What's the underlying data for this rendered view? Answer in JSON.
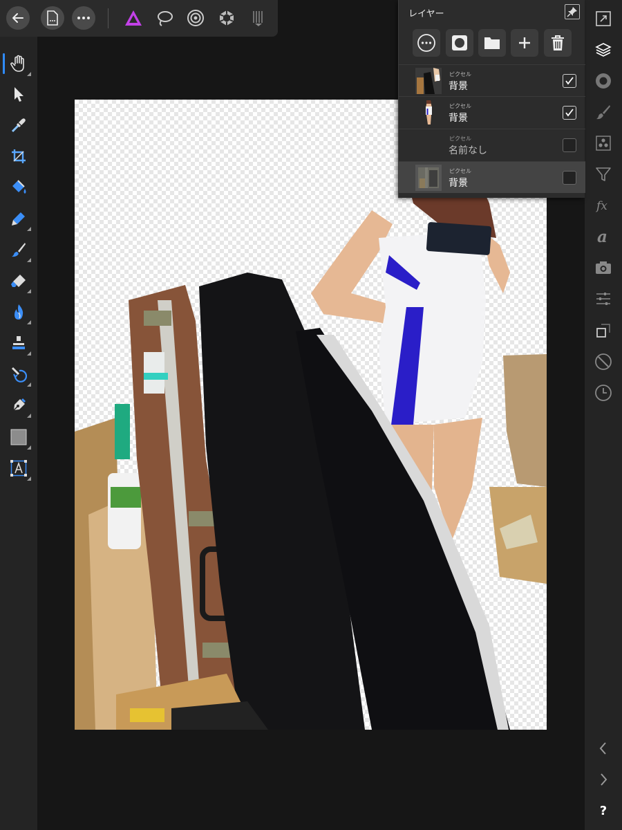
{
  "colors": {
    "background": "#161616",
    "toolbar": "#2b2b2b",
    "panel": "#2c2c2c",
    "accent": "#2f8cff",
    "affinity_photo_icon": "#c341e8"
  },
  "top_toolbar": {
    "icons": [
      "back-arrow-icon",
      "document-icon",
      "more-icon",
      "photo-persona-icon",
      "selection-persona-icon",
      "liquify-persona-icon",
      "develop-persona-icon",
      "export-persona-icon"
    ]
  },
  "left_tools": {
    "icons": [
      "hand-icon",
      "move-icon",
      "color-picker-icon",
      "crop-icon",
      "fill-icon",
      "selection-brush-icon",
      "paint-brush-icon",
      "eraser-icon",
      "burn-icon",
      "clone-icon",
      "healing-icon",
      "pen-icon",
      "rectangle-icon",
      "text-icon"
    ],
    "active": "hand-icon"
  },
  "right_bar": {
    "icons": [
      "navigator-icon",
      "layers-icon",
      "color-icon",
      "brushes-icon",
      "channels-icon",
      "filter-icon",
      "fx-icon",
      "text-styles-icon",
      "snapshots-icon",
      "adjustments-icon",
      "transform-icon",
      "stock-icon",
      "history-icon"
    ],
    "bottom": {
      "help_label": "?",
      "nav_icons": [
        "chevron-left-icon",
        "chevron-right-icon"
      ]
    }
  },
  "layers_panel": {
    "title": "レイヤー",
    "actions": [
      "options-icon",
      "mask-icon",
      "group-folder-icon",
      "add-layer-icon",
      "delete-icon"
    ],
    "layers": [
      {
        "type": "ピクセル",
        "name": "背景",
        "visible": true,
        "selected": false
      },
      {
        "type": "ピクセル",
        "name": "背景",
        "visible": true,
        "selected": false
      },
      {
        "type": "ピクセル",
        "name": "名前なし",
        "visible": false,
        "selected": false
      },
      {
        "type": "ピクセル",
        "name": "背景",
        "visible": false,
        "selected": true
      }
    ]
  }
}
